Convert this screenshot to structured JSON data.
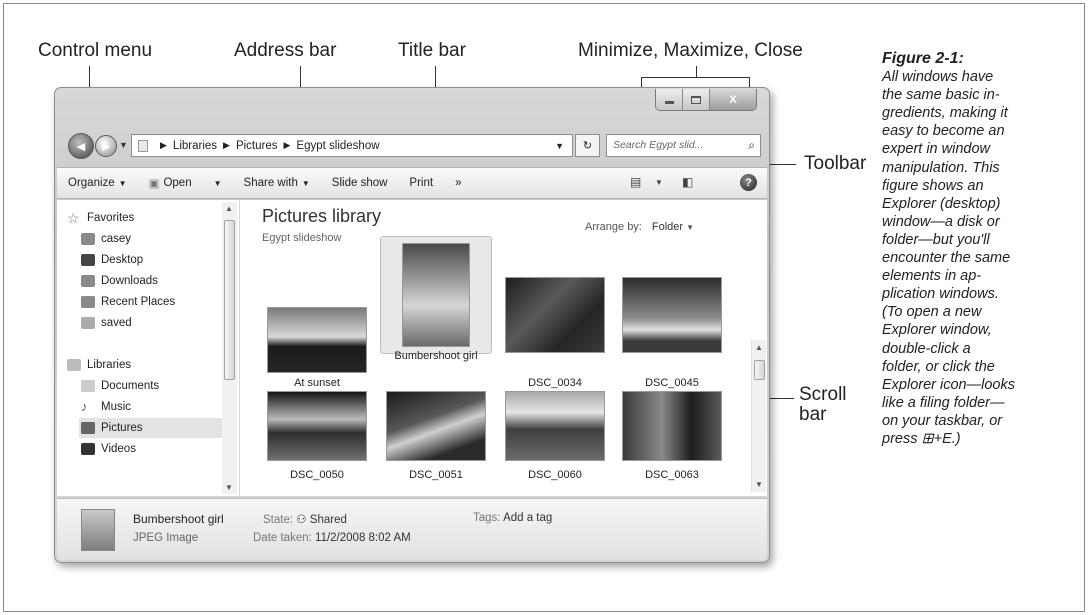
{
  "callouts": {
    "control_menu": "Control menu",
    "address_bar": "Address bar",
    "title_bar": "Title bar",
    "window_buttons": "Minimize, Maximize, Close",
    "toolbar": "Toolbar",
    "scroll_bar_line1": "Scroll",
    "scroll_bar_line2": "bar"
  },
  "caption": {
    "title": "Figure 2-1:",
    "lines": [
      "All windows have",
      "the same basic in-",
      "gredients, making it",
      "easy to become an",
      "expert in window",
      "manipulation. This",
      "figure shows an",
      "Explorer (desktop)",
      "window—a disk or",
      "folder—but you'll",
      "encounter the same",
      "elements in ap-",
      "plication windows.",
      "(To open a new",
      "Explorer window,",
      "double-click a",
      "folder, or click the",
      "Explorer icon—looks",
      "like a filing folder—",
      "on your taskbar, or",
      "press ⊞+E.)"
    ]
  },
  "window": {
    "close_glyph": "X",
    "address": {
      "crumbs": [
        "Libraries",
        "Pictures",
        "Egypt slideshow"
      ]
    },
    "search_placeholder": "Search Egypt slid...",
    "toolbar": {
      "organize": "Organize",
      "open": "Open",
      "share_with": "Share with",
      "slide_show": "Slide show",
      "print": "Print",
      "more": "»"
    },
    "nav": {
      "favorites": "Favorites",
      "casey": "casey",
      "desktop": "Desktop",
      "downloads": "Downloads",
      "recent_places": "Recent Places",
      "saved": "saved",
      "libraries": "Libraries",
      "documents": "Documents",
      "music": "Music",
      "pictures": "Pictures",
      "videos": "Videos"
    },
    "content": {
      "title": "Pictures library",
      "subtitle": "Egypt slideshow",
      "arrange_label": "Arrange by:",
      "arrange_value": "Folder"
    },
    "thumbnails": [
      {
        "name": "At sunset"
      },
      {
        "name": "Bumbershoot girl"
      },
      {
        "name": "DSC_0034"
      },
      {
        "name": "DSC_0045"
      },
      {
        "name": "DSC_0050"
      },
      {
        "name": "DSC_0051"
      },
      {
        "name": "DSC_0060"
      },
      {
        "name": "DSC_0063"
      }
    ],
    "details": {
      "file_name": "Bumbershoot girl",
      "file_type": "JPEG Image",
      "state_label": "State:",
      "state_value": "Shared",
      "date_label": "Date taken:",
      "date_value": "11/2/2008 8:02 AM",
      "tags_label": "Tags:",
      "tags_value": "Add a tag"
    }
  }
}
